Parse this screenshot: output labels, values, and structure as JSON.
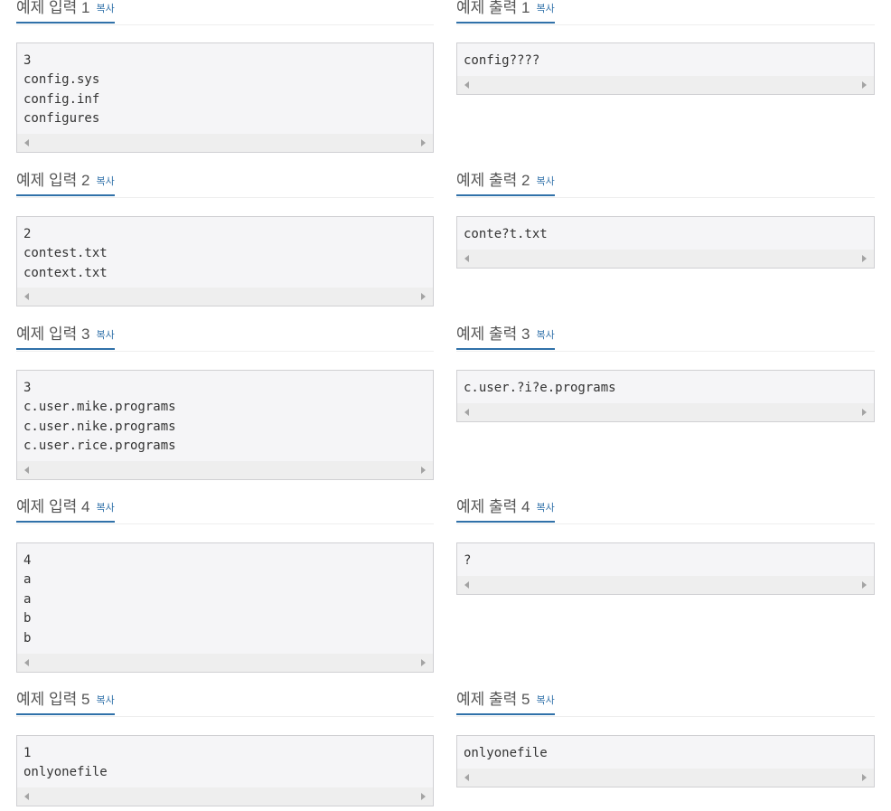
{
  "copy_label": "복사",
  "samples": [
    {
      "input_title": "예제 입력 1",
      "input_lines": "3\nconfig.sys\nconfig.inf\nconfigures",
      "output_title": "예제 출력 1",
      "output_lines": "config????"
    },
    {
      "input_title": "예제 입력 2",
      "input_lines": "2\ncontest.txt\ncontext.txt",
      "output_title": "예제 출력 2",
      "output_lines": "conte?t.txt"
    },
    {
      "input_title": "예제 입력 3",
      "input_lines": "3\nc.user.mike.programs\nc.user.nike.programs\nc.user.rice.programs",
      "output_title": "예제 출력 3",
      "output_lines": "c.user.?i?e.programs"
    },
    {
      "input_title": "예제 입력 4",
      "input_lines": "4\na\na\nb\nb",
      "output_title": "예제 출력 4",
      "output_lines": "?"
    },
    {
      "input_title": "예제 입력 5",
      "input_lines": "1\nonlyonefile",
      "output_title": "예제 출력 5",
      "output_lines": "onlyonefile"
    }
  ]
}
